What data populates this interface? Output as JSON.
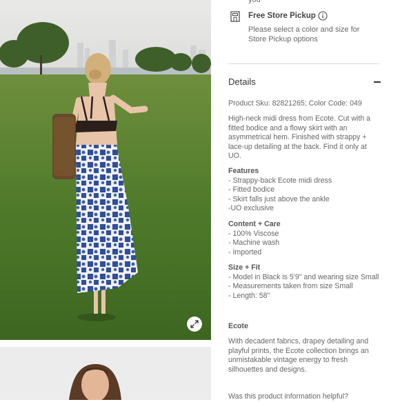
{
  "pickup": {
    "cut_text": "you",
    "title": "Free Store Pickup",
    "description": "Please select a color and size for Store Pickup options",
    "icons": {
      "store": "store-icon",
      "info": "info-icon"
    }
  },
  "details": {
    "title": "Details",
    "collapse_icon": "minus-icon",
    "sku_line": "Product Sku: 82821265; Color Code: 049",
    "description": "High-neck midi dress from Ecote. Cut with a fitted bodice and a flowy skirt with an asymmetrical hem. Finished with strappy + lace-up detailing at the back. Find it only at UO.",
    "features": {
      "heading": "Features",
      "items": [
        "- Strappy-back Ecote midi dress",
        "- Fitted bodice",
        "- Skirt falls just above the ankle",
        "-UO exclusive"
      ]
    },
    "content_care": {
      "heading": "Content + Care",
      "items": [
        "- 100% Viscose",
        "- Machine wash",
        "- Imported"
      ]
    },
    "size_fit": {
      "heading": "Size + Fit",
      "items": [
        "- Model in Black is 5'9\" and wearing size Small",
        "- Measurements taken from size Small",
        "- Length: 58\""
      ]
    },
    "brand": {
      "heading": "Ecote",
      "description": "With decadent fabrics, drapey detailing and playful prints, the Ecote collection brings an unmistakable vintage energy to fresh silhouettes and designs."
    },
    "feedback_question": "Was this product information helpful?"
  },
  "gallery": {
    "expand_icon": "expand-icon"
  },
  "colors": {
    "text": "#666666",
    "heading": "#333333",
    "divider": "#d9d9d9",
    "dress_blue": "#2f4f9a",
    "grass": "#4f7a2a"
  }
}
